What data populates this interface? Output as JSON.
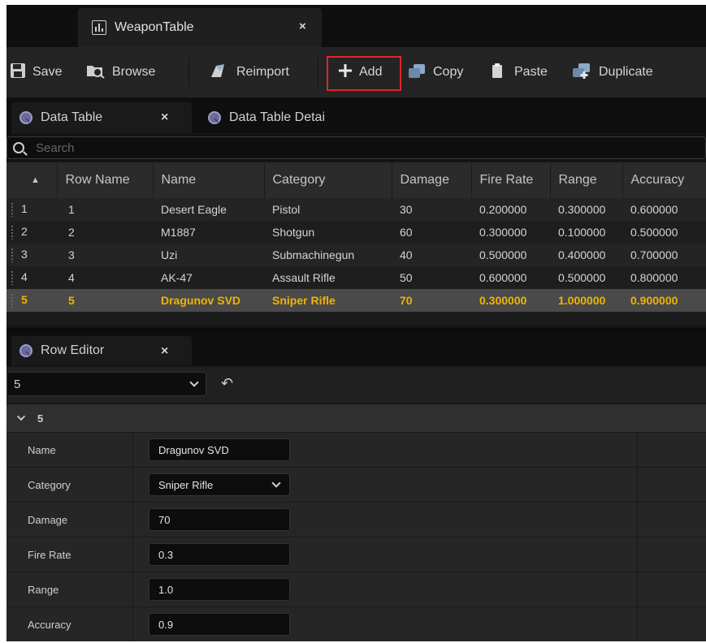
{
  "window": {
    "doc_tab_title": "WeaponTable",
    "doc_tab_close": "×"
  },
  "toolbar": {
    "save": "Save",
    "browse": "Browse",
    "reimport": "Reimport",
    "add": "Add",
    "copy": "Copy",
    "paste": "Paste",
    "duplicate": "Duplicate",
    "highlight_color": "#e0252d"
  },
  "panel_tabs": {
    "data_table": "Data Table",
    "data_table_close": "×",
    "data_table_details": "Data Table Detai"
  },
  "search": {
    "placeholder": "Search"
  },
  "table": {
    "sort_indicator": "▲",
    "headers": [
      "Row Name",
      "Name",
      "Category",
      "Damage",
      "Fire Rate",
      "Range",
      "Accuracy"
    ],
    "rows": [
      {
        "index": "1",
        "row_name": "1",
        "name": "Desert Eagle",
        "category": "Pistol",
        "damage": "30",
        "fire_rate": "0.200000",
        "range": "0.300000",
        "accuracy": "0.600000"
      },
      {
        "index": "2",
        "row_name": "2",
        "name": "M1887",
        "category": "Shotgun",
        "damage": "60",
        "fire_rate": "0.300000",
        "range": "0.100000",
        "accuracy": "0.500000"
      },
      {
        "index": "3",
        "row_name": "3",
        "name": "Uzi",
        "category": "Submachinegun",
        "damage": "40",
        "fire_rate": "0.500000",
        "range": "0.400000",
        "accuracy": "0.700000"
      },
      {
        "index": "4",
        "row_name": "4",
        "name": "AK-47",
        "category": "Assault Rifle",
        "damage": "50",
        "fire_rate": "0.600000",
        "range": "0.500000",
        "accuracy": "0.800000"
      },
      {
        "index": "5",
        "row_name": "5",
        "name": "Dragunov SVD",
        "category": "Sniper Rifle",
        "damage": "70",
        "fire_rate": "0.300000",
        "range": "1.000000",
        "accuracy": "0.900000"
      }
    ],
    "selected_index": 4,
    "selected_color": "#f0b400"
  },
  "row_editor": {
    "tab_label": "Row Editor",
    "tab_close": "×",
    "selected_row": "5",
    "undo_glyph": "↶",
    "category_header": "5",
    "props": [
      {
        "label": "Name",
        "value": "Dragunov SVD"
      },
      {
        "label": "Category",
        "value": "Sniper Rifle"
      },
      {
        "label": "Damage",
        "value": "70"
      },
      {
        "label": "Fire Rate",
        "value": "0.3"
      },
      {
        "label": "Range",
        "value": "1.0"
      },
      {
        "label": "Accuracy",
        "value": "0.9"
      }
    ]
  }
}
